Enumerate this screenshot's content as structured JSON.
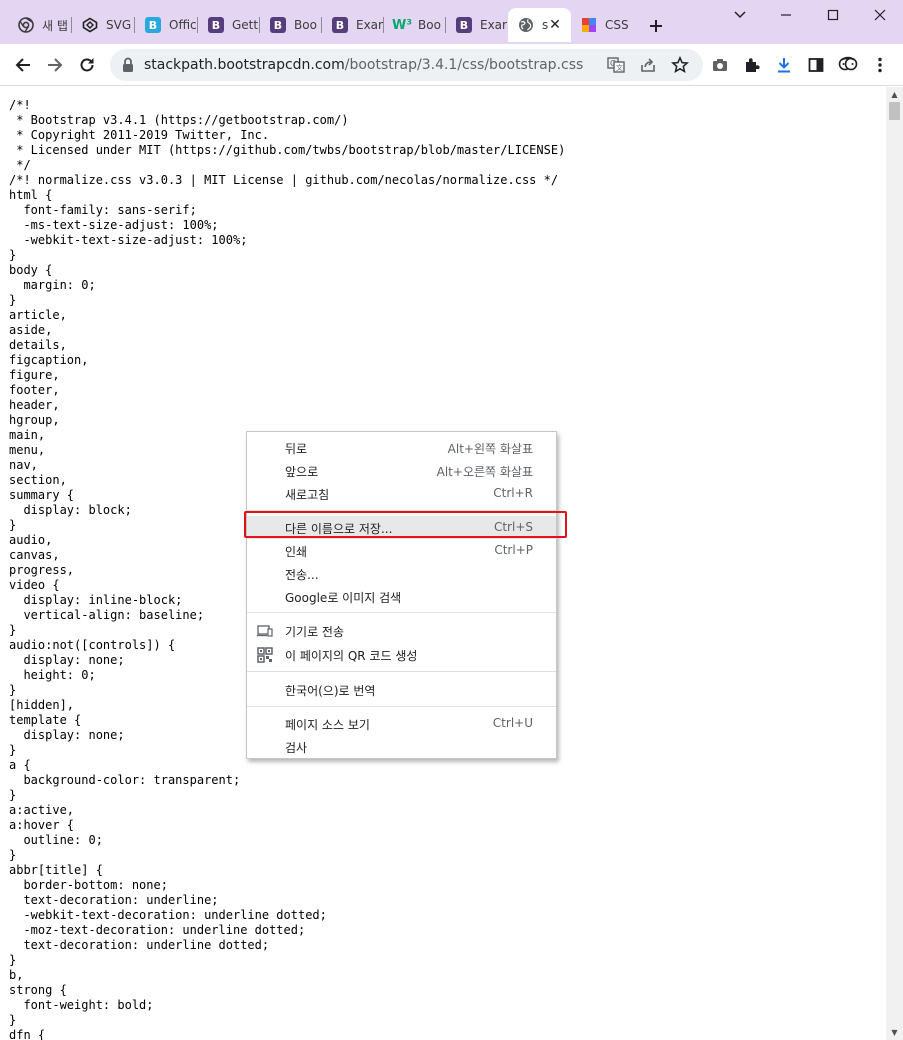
{
  "tabs": [
    {
      "title": "새 탭",
      "favicon": "chrome-icon"
    },
    {
      "title": "SVG",
      "favicon": "codepen-icon"
    },
    {
      "title": "Offic",
      "favicon": "bootstrap-blue-icon"
    },
    {
      "title": "Gett",
      "favicon": "bootstrap-purple-icon"
    },
    {
      "title": "Boo",
      "favicon": "bootstrap-purple-icon"
    },
    {
      "title": "Exar",
      "favicon": "bootstrap-purple-icon"
    },
    {
      "title": "Boo",
      "favicon": "w3schools-icon"
    },
    {
      "title": "Exar",
      "favicon": "bootstrap-purple-icon"
    },
    {
      "title": "s",
      "favicon": "globe-icon",
      "active": true
    },
    {
      "title": "CSS",
      "favicon": "colorful-grid-icon"
    }
  ],
  "address": {
    "url_host": "stackpath.bootstrapcdn.com",
    "url_path": "/bootstrap/3.4.1/css/bootstrap.css"
  },
  "code_lines": [
    "/*!",
    " * Bootstrap v3.4.1 (https://getbootstrap.com/)",
    " * Copyright 2011-2019 Twitter, Inc.",
    " * Licensed under MIT (https://github.com/twbs/bootstrap/blob/master/LICENSE)",
    " */",
    "/*! normalize.css v3.0.3 | MIT License | github.com/necolas/normalize.css */",
    "html {",
    "  font-family: sans-serif;",
    "  -ms-text-size-adjust: 100%;",
    "  -webkit-text-size-adjust: 100%;",
    "}",
    "body {",
    "  margin: 0;",
    "}",
    "article,",
    "aside,",
    "details,",
    "figcaption,",
    "figure,",
    "footer,",
    "header,",
    "hgroup,",
    "main,",
    "menu,",
    "nav,",
    "section,",
    "summary {",
    "  display: block;",
    "}",
    "audio,",
    "canvas,",
    "progress,",
    "video {",
    "  display: inline-block;",
    "  vertical-align: baseline;",
    "}",
    "audio:not([controls]) {",
    "  display: none;",
    "  height: 0;",
    "}",
    "[hidden],",
    "template {",
    "  display: none;",
    "}",
    "a {",
    "  background-color: transparent;",
    "}",
    "a:active,",
    "a:hover {",
    "  outline: 0;",
    "}",
    "abbr[title] {",
    "  border-bottom: none;",
    "  text-decoration: underline;",
    "  -webkit-text-decoration: underline dotted;",
    "  -moz-text-decoration: underline dotted;",
    "  text-decoration: underline dotted;",
    "}",
    "b,",
    "strong {",
    "  font-weight: bold;",
    "}",
    "dfn {"
  ],
  "context_menu": {
    "back": {
      "label": "뒤로",
      "shortcut": "Alt+왼쪽 화살표"
    },
    "forward": {
      "label": "앞으로",
      "shortcut": "Alt+오른쪽 화살표"
    },
    "reload": {
      "label": "새로고침",
      "shortcut": "Ctrl+R"
    },
    "save_as": {
      "label": "다른 이름으로 저장...",
      "shortcut": "Ctrl+S"
    },
    "print": {
      "label": "인쇄",
      "shortcut": "Ctrl+P"
    },
    "cast": {
      "label": "전송..."
    },
    "search_image": {
      "label": "Google로 이미지 검색"
    },
    "send_to_devices": {
      "label": "기기로 전송"
    },
    "qr_code": {
      "label": "이 페이지의 QR 코드 생성"
    },
    "translate": {
      "label": "한국어(으)로 번역"
    },
    "view_source": {
      "label": "페이지 소스 보기",
      "shortcut": "Ctrl+U"
    },
    "inspect": {
      "label": "검사"
    }
  },
  "colors": {
    "tabstrip_bg": "#e4d6f2",
    "highlight_box": "#e4111a",
    "download_accent": "#1a73e8"
  }
}
